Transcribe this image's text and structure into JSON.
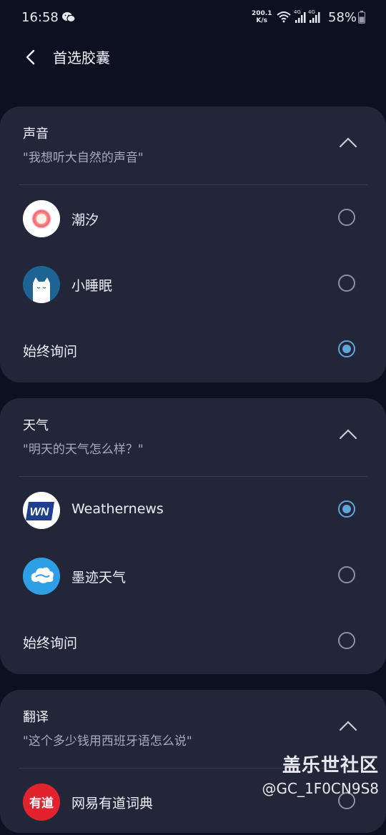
{
  "status_bar": {
    "time": "16:58",
    "net_speed_value": "200.1",
    "net_speed_unit": "K/s",
    "net1": "4G",
    "net2": "4G",
    "battery": "58%",
    "icons": [
      "wechat-icon",
      "wifi-icon",
      "signal-icon",
      "signal-icon",
      "battery-icon"
    ]
  },
  "header": {
    "title": "首选胶囊",
    "back_icon": "back-arrow-icon"
  },
  "sections": [
    {
      "name": "声音",
      "example": "\"我想听大自然的声音\"",
      "expanded": true,
      "options": [
        {
          "label": "潮汐",
          "icon": "tide-app-icon",
          "selected": false
        },
        {
          "label": "小睡眠",
          "icon": "sleep-app-icon",
          "selected": false
        },
        {
          "label": "始终询问",
          "selected": true
        }
      ]
    },
    {
      "name": "天气",
      "example": "\"明天的天气怎么样？\"",
      "expanded": true,
      "options": [
        {
          "label": "Weathernews",
          "icon": "weathernews-app-icon",
          "selected": true
        },
        {
          "label": "墨迹天气",
          "icon": "moji-weather-app-icon",
          "selected": false
        },
        {
          "label": "始终询问",
          "selected": false
        }
      ]
    },
    {
      "name": "翻译",
      "example": "\"这个多少钱用西班牙语怎么说\"",
      "expanded": true,
      "options": [
        {
          "label": "网易有道词典",
          "icon": "youdao-app-icon",
          "selected": false
        }
      ]
    }
  ],
  "app_icon_text": {
    "weathernews": "WN",
    "youdao": "有道"
  },
  "watermark": {
    "line1": "盖乐世社区",
    "line2": "@GC_1F0CN9S8"
  },
  "colors": {
    "background": "#0d1020",
    "card": "#232639",
    "accent_radio": "#5fa6d9"
  }
}
